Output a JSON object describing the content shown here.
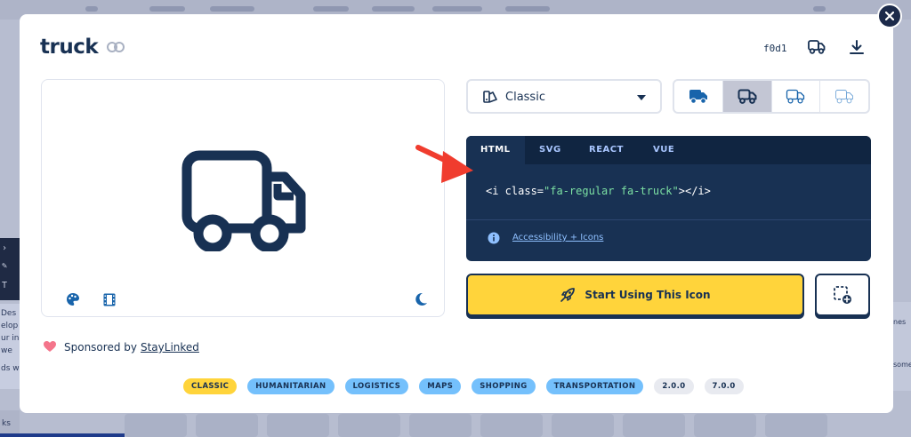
{
  "icon": {
    "name": "truck",
    "unicode": "f0d1"
  },
  "style_select": {
    "label": "Classic"
  },
  "variants": [
    "solid",
    "regular",
    "light",
    "thin"
  ],
  "code": {
    "tabs": [
      "HTML",
      "SVG",
      "REACT",
      "VUE"
    ],
    "active_tab": "HTML",
    "snippet_prefix": "<i class=",
    "snippet_string": "\"fa-regular fa-truck\"",
    "snippet_suffix": "></i>",
    "accessibility_link": "Accessibility + Icons"
  },
  "cta": {
    "label": "Start Using This Icon"
  },
  "sponsor": {
    "prefix": "Sponsored by",
    "name": "StayLinked"
  },
  "tags": [
    "CLASSIC",
    "HUMANITARIAN",
    "LOGISTICS",
    "MAPS",
    "SHOPPING",
    "TRANSPORTATION",
    "2.0.0",
    "7.0.0"
  ],
  "background": {
    "left_card_lines": [
      "Des",
      "elop",
      "ur in",
      " we",
      "ds w"
    ],
    "right_card_lines": [
      "nes",
      "some"
    ],
    "bottom_left_text": "ks"
  },
  "colors": {
    "navy": "#183153",
    "yellow": "#ffd43b",
    "blue_tag": "#74c0fc",
    "arrow_red": "#f03c2e"
  },
  "icons": [
    "link-icon",
    "truck-icon",
    "download-icon",
    "palette-icon",
    "film-icon",
    "moon-icon",
    "info-icon",
    "rocket-icon",
    "add-to-collection-icon",
    "heart-icon",
    "close-icon"
  ]
}
